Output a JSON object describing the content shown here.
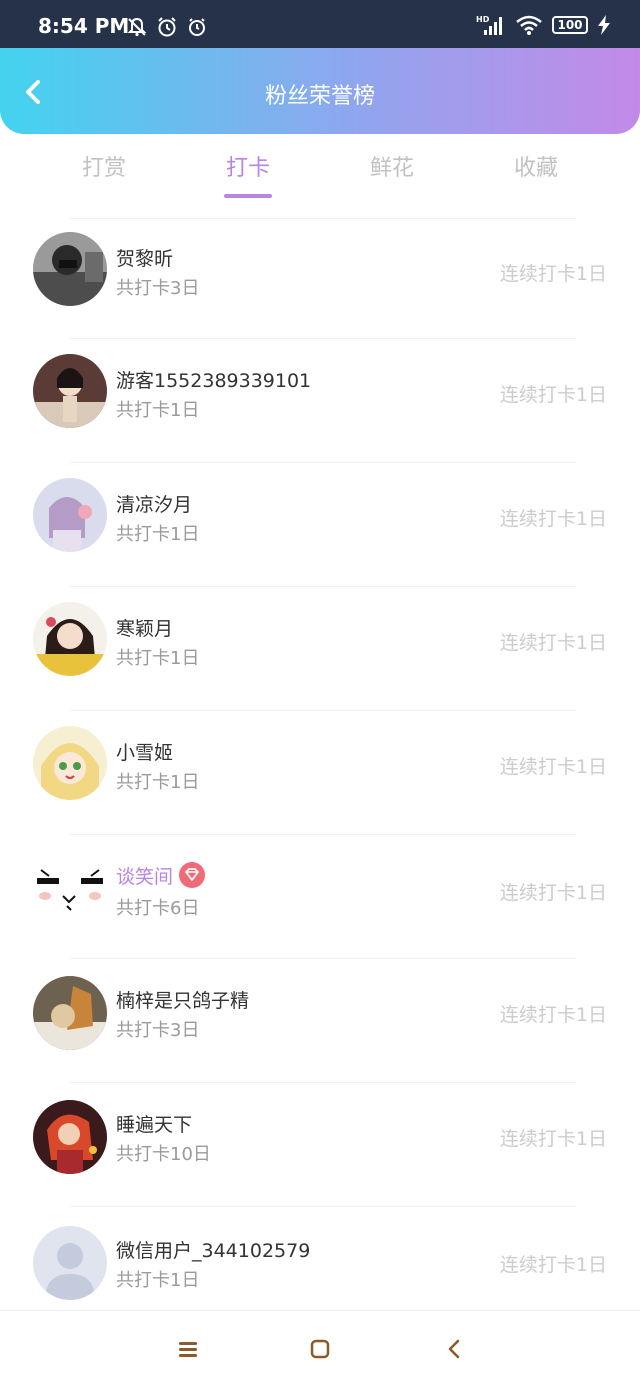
{
  "status_bar": {
    "time": "8:54 PM",
    "battery": "100",
    "icons": [
      "notification-off-icon",
      "alarm-icon",
      "alarm-icon",
      "hd-signal-icon",
      "wifi-icon",
      "battery-icon",
      "charging-icon"
    ]
  },
  "header": {
    "title": "粉丝荣誉榜",
    "back_icon": "chevron-left-icon"
  },
  "tabs": [
    {
      "label": "打赏",
      "active": false
    },
    {
      "label": "打卡",
      "active": true
    },
    {
      "label": "鲜花",
      "active": false
    },
    {
      "label": "收藏",
      "active": false
    }
  ],
  "colors": {
    "accent": "#b985e3",
    "header_gradient_start": "#43d3ef",
    "header_gradient_end": "#c38ae8",
    "vip_badge": "#f06a77"
  },
  "fans": [
    {
      "name": "贺黎昕",
      "total": "共打卡3日",
      "streak": "连续打卡1日",
      "vip": false
    },
    {
      "name": "游客1552389339101",
      "total": "共打卡1日",
      "streak": "连续打卡1日",
      "vip": false
    },
    {
      "name": "清凉汐月",
      "total": "共打卡1日",
      "streak": "连续打卡1日",
      "vip": false
    },
    {
      "name": "寒颖月",
      "total": "共打卡1日",
      "streak": "连续打卡1日",
      "vip": false
    },
    {
      "name": "小雪姬",
      "total": "共打卡1日",
      "streak": "连续打卡1日",
      "vip": false
    },
    {
      "name": "谈笑间",
      "total": "共打卡6日",
      "streak": "连续打卡1日",
      "vip": true
    },
    {
      "name": "楠梓是只鸽子精",
      "total": "共打卡3日",
      "streak": "连续打卡1日",
      "vip": false
    },
    {
      "name": "睡遍天下",
      "total": "共打卡10日",
      "streak": "连续打卡1日",
      "vip": false
    },
    {
      "name": "微信用户_344102579",
      "total": "共打卡1日",
      "streak": "连续打卡1日",
      "vip": false
    }
  ],
  "nav": {
    "icons": [
      "menu-icon",
      "home-square-icon",
      "back-triangle-icon"
    ]
  }
}
